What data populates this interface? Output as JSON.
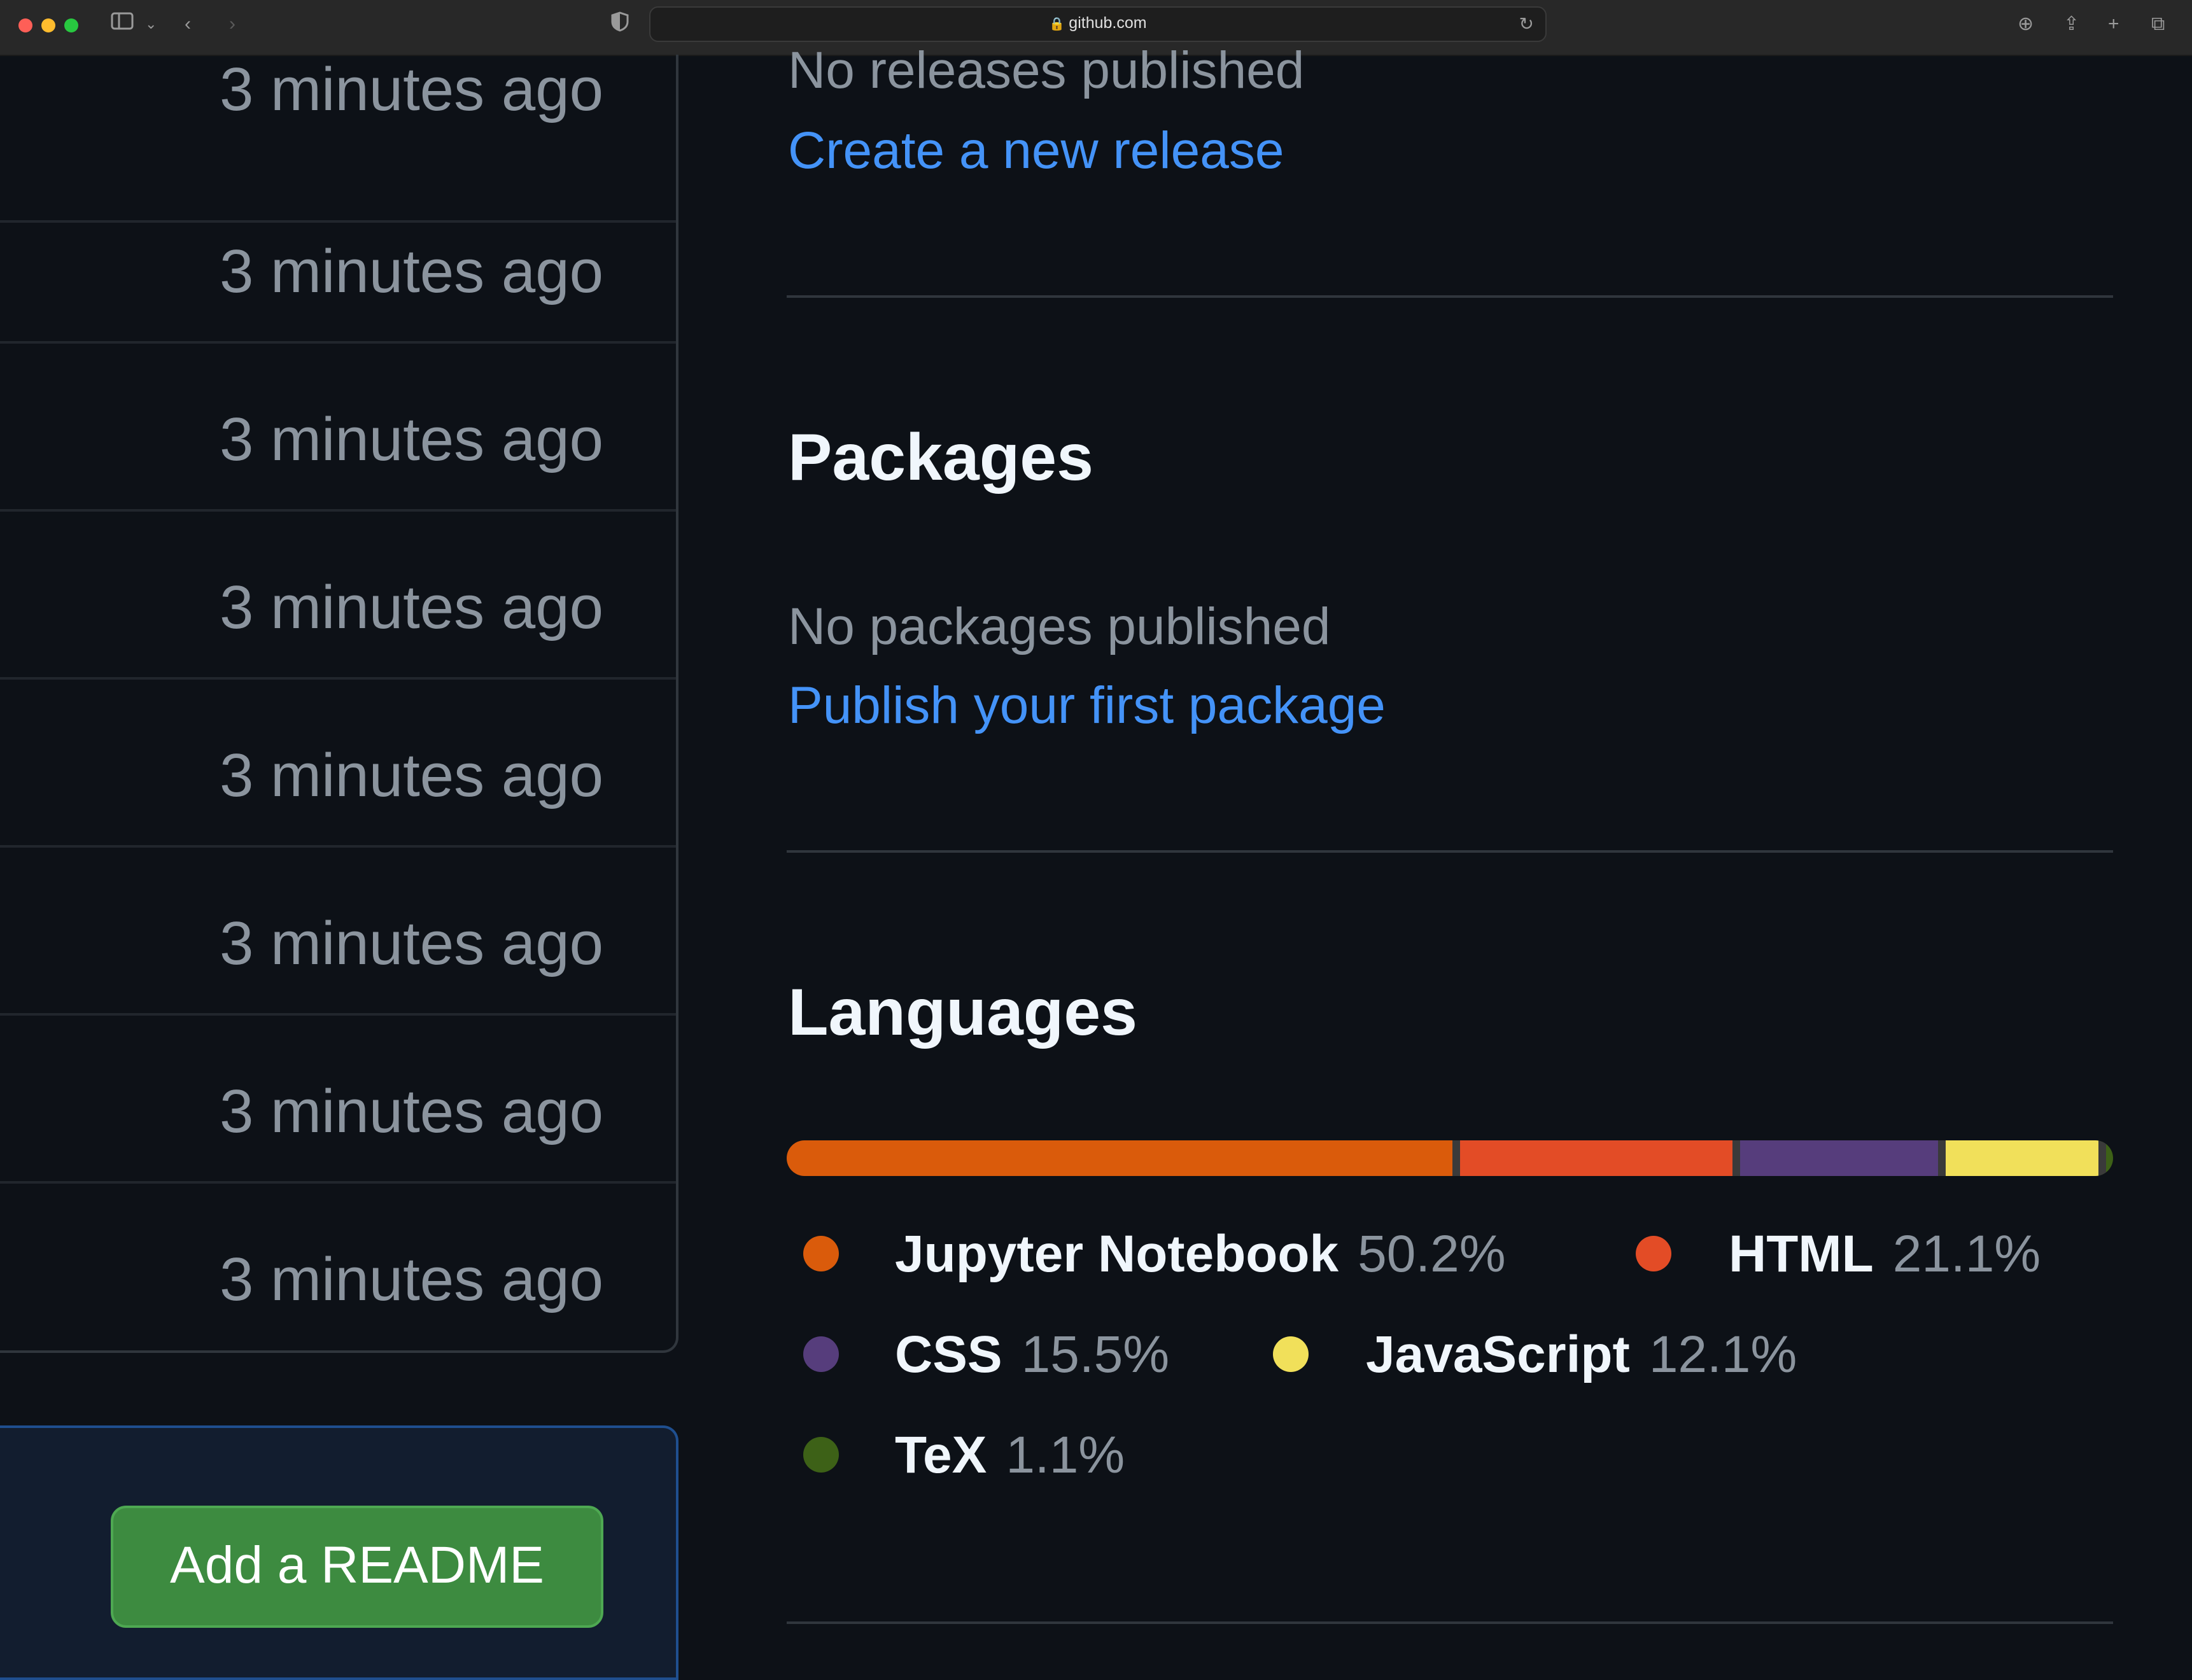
{
  "browser": {
    "url": "github.com",
    "colors": {
      "close": "#fe5f57",
      "minimize": "#febc2e",
      "zoom": "#28c840"
    }
  },
  "file_list": {
    "rows": [
      {
        "time": "3 minutes ago"
      },
      {
        "time": "3 minutes ago"
      },
      {
        "time": "3 minutes ago"
      },
      {
        "time": "3 minutes ago"
      },
      {
        "time": "3 minutes ago"
      },
      {
        "time": "3 minutes ago"
      },
      {
        "time": "3 minutes ago"
      },
      {
        "time": "3 minutes ago"
      }
    ]
  },
  "readme": {
    "button_label": "Add a README"
  },
  "releases": {
    "empty_text": "No releases published",
    "create_link": "Create a new release"
  },
  "packages": {
    "title": "Packages",
    "empty_text": "No packages published",
    "publish_link": "Publish your first package"
  },
  "languages": {
    "title": "Languages",
    "items": [
      {
        "name": "Jupyter Notebook",
        "percent_label": "50.2%",
        "percent": 50.2,
        "color": "#da5b0b"
      },
      {
        "name": "HTML",
        "percent_label": "21.1%",
        "percent": 21.1,
        "color": "#e34c26"
      },
      {
        "name": "CSS",
        "percent_label": "15.5%",
        "percent": 15.5,
        "color": "#563d7c"
      },
      {
        "name": "JavaScript",
        "percent_label": "12.1%",
        "percent": 12.1,
        "color": "#f1e05a"
      },
      {
        "name": "TeX",
        "percent_label": "1.1%",
        "percent": 1.1,
        "color": "#3d6117"
      }
    ]
  },
  "colors": {
    "link": "#4493f8",
    "readme_button": "#3d8b40",
    "background": "#0d1117"
  }
}
